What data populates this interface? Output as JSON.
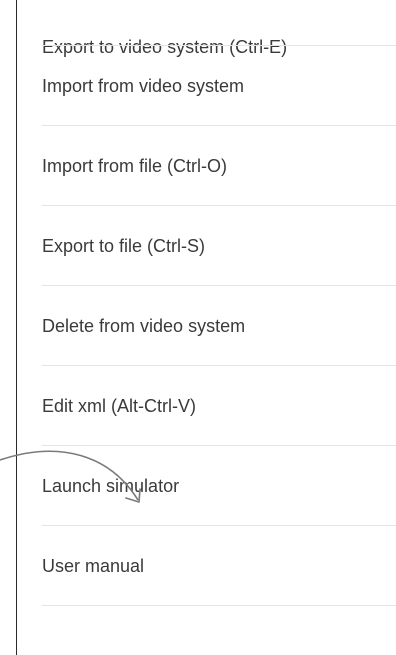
{
  "menu": {
    "items": [
      {
        "label": "Export to video system (Ctrl-E)"
      },
      {
        "label": "Import from video system"
      },
      {
        "label": "Import from file (Ctrl-O)"
      },
      {
        "label": "Export to file (Ctrl-S)"
      },
      {
        "label": "Delete from video system"
      },
      {
        "label": "Edit xml (Alt-Ctrl-V)"
      },
      {
        "label": "Launch simulator"
      },
      {
        "label": "User manual"
      }
    ]
  },
  "annotation": {
    "color": "#7a7a7a",
    "icon": "callout-arrow-icon"
  }
}
